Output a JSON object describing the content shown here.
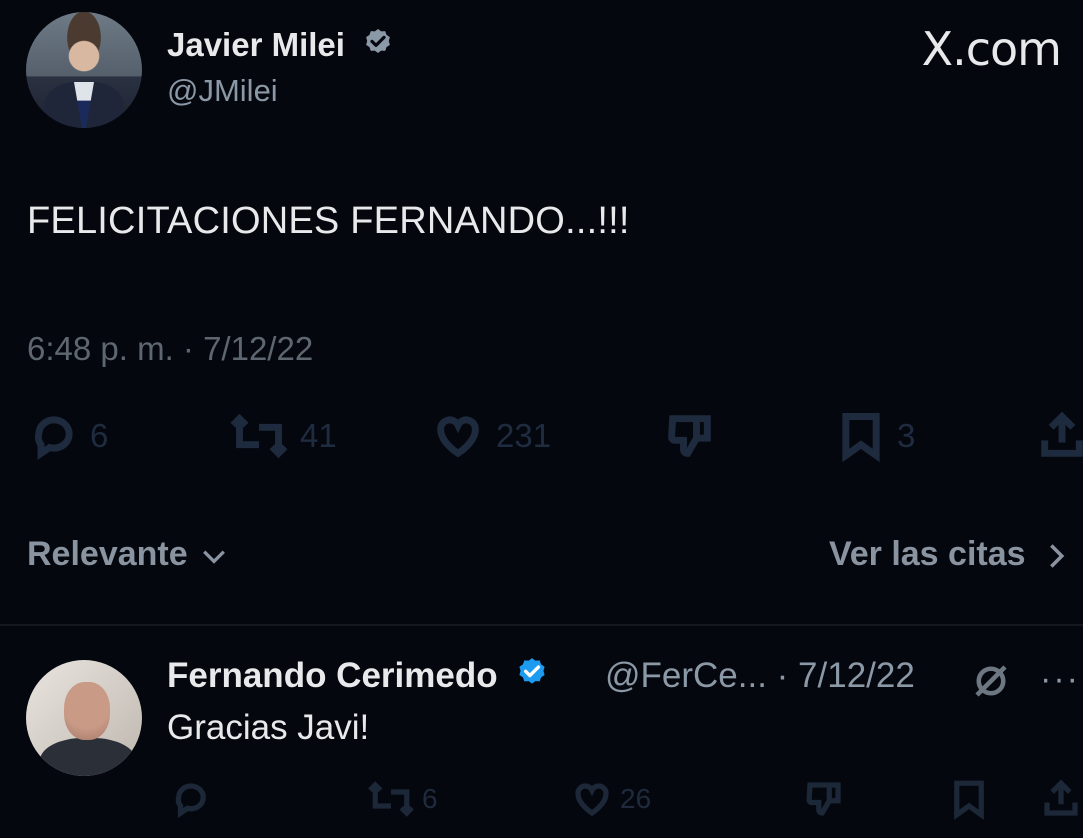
{
  "tweet": {
    "author_name": "Javier Milei",
    "author_handle": "@JMilei",
    "brand": "X.com",
    "text": "FELICITACIONES FERNANDO...!!!",
    "timestamp": "6:48 p. m. · 7/12/22",
    "stats": {
      "replies": "6",
      "retweets": "41",
      "likes": "231",
      "bookmarks": "3"
    }
  },
  "filter": {
    "sort_label": "Relevante",
    "quotes_label": "Ver las citas"
  },
  "reply": {
    "author_name": "Fernando Cerimedo",
    "meta": "@FerCe... · 7/12/22",
    "text": "Gracias Javi!",
    "stats": {
      "retweets": "6",
      "likes": "26"
    }
  },
  "colors": {
    "background": "#05070f",
    "verified": "#1d9bf0",
    "primary_text": "#e7e9ea",
    "secondary_text": "#8b98a5"
  },
  "icons": [
    "verified-badge-icon",
    "reply-icon",
    "retweet-icon",
    "like-icon",
    "dislike-icon",
    "bookmark-icon",
    "share-icon",
    "chevron-down-icon",
    "chevron-right-icon",
    "grok-icon",
    "more-icon"
  ]
}
